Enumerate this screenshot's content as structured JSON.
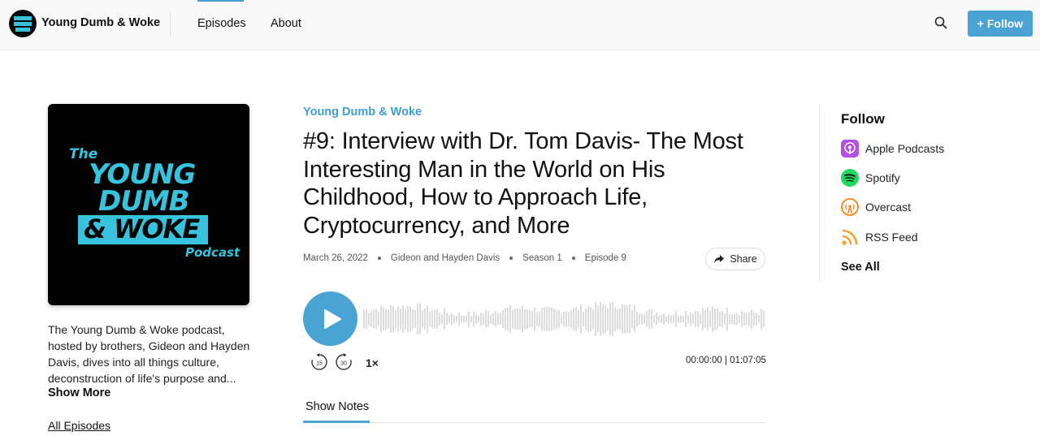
{
  "header": {
    "brand": "Young Dumb & Woke",
    "nav": [
      "Episodes",
      "About"
    ],
    "follow_button": "+ Follow"
  },
  "cover": {
    "line_the": "The",
    "line_young": "YOUNG",
    "line_dumb": "DUMB",
    "line_woke": "& WOKE",
    "line_podcast": "Podcast"
  },
  "sidebar_left": {
    "description": "The Young Dumb & Woke podcast, hosted by brothers, Gideon and Hayden Davis, dives into all things culture, deconstruction of life's purpose and...",
    "show_more": "Show More",
    "all_episodes": "All Episodes"
  },
  "episode": {
    "podcast_name": "Young Dumb & Woke",
    "title": "#9: Interview with Dr. Tom Davis- The Most Interesting Man in the World on His Childhood, How to Approach Life, Cryptocurrency, and More",
    "date": "March 26, 2022",
    "hosts": "Gideon and Hayden Davis",
    "season": "Season 1",
    "episode_number": "Episode 9",
    "share_label": "Share"
  },
  "player": {
    "skip_back": "15",
    "skip_forward": "30",
    "speed": "1×",
    "current_time": "00:00:00",
    "separator": "|",
    "duration": "01:07:05",
    "progress": 0
  },
  "tabs": {
    "show_notes": "Show Notes"
  },
  "follow_panel": {
    "heading": "Follow",
    "platforms": [
      {
        "label": "Apple Podcasts",
        "icon": "apple-podcasts-icon"
      },
      {
        "label": "Spotify",
        "icon": "spotify-icon"
      },
      {
        "label": "Overcast",
        "icon": "overcast-icon"
      },
      {
        "label": "RSS Feed",
        "icon": "rss-icon"
      }
    ],
    "see_all": "See All"
  },
  "colors": {
    "accent": "#4ba3d5",
    "cover_cyan": "#37c3de",
    "apple": "#b150e2",
    "spotify": "#1ed760",
    "overcast": "#fc7e0f",
    "rss": "#f7a033",
    "waveform": "#dcdcdc"
  }
}
